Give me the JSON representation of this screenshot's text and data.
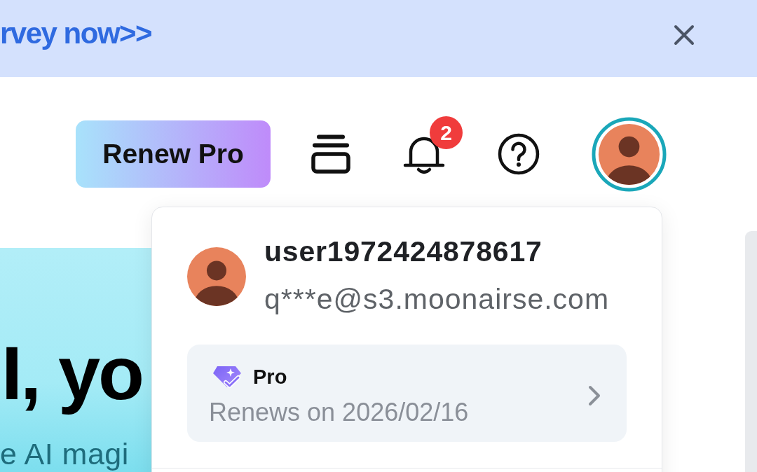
{
  "banner": {
    "link_text": "rvey now>>"
  },
  "header": {
    "renew_button": "Renew Pro",
    "notification_count": "2"
  },
  "hero": {
    "title": "I, yo",
    "subtitle": "e AI magi"
  },
  "account_menu": {
    "username": "user1972424878617",
    "email": "q***e@s3.moonairse.com",
    "plan": {
      "name": "Pro",
      "renewal": "Renews on 2026/02/16"
    }
  }
}
